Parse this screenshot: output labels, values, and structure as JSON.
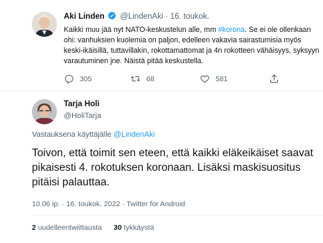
{
  "tweet1": {
    "name": "Aki Linden",
    "handle": "@LindenAki",
    "date": "16. toukok.",
    "text_before": "Kaikki muu jää nyt NATO-keskustelun alle, mm ",
    "hashtag": "#korona",
    "text_after": ". Se ei ole ollenkaan ohi: vanhuksien kuolemia on paljon, edelleen vakavia sairastumisia myös keski-ikäisillä, tuttavillakin, rokottamattomat ja 4n rokotteen vähäisyys, syksyyn varautuminen jne. Näistä pitää keskustella.",
    "replies": "305",
    "retweets": "68",
    "likes": "581"
  },
  "tweet2": {
    "name": "Tarja Holi",
    "handle": "@HoliTarja",
    "reply_prefix": "Vastauksena käyttäjälle ",
    "reply_handle": "@LindenAki",
    "text": "Toivon, että toimit sen eteen, että kaikki eläkeikäiset saavat pikaisesti 4. rokotuksen koronaan. Lisäksi maskisuositus pitäisi palauttaa.",
    "time": "10.06 ip.",
    "date": "16. toukok. 2022",
    "source": "Twitter for Android",
    "sep": "·",
    "retweets_count": "2",
    "retweets_label": "uudelleentwiittausta",
    "likes_count": "30",
    "likes_label": "tykkäystä"
  },
  "colors": {
    "accent": "#1d9bf0",
    "secondary_text": "#536471",
    "divider": "#eff3f4"
  }
}
